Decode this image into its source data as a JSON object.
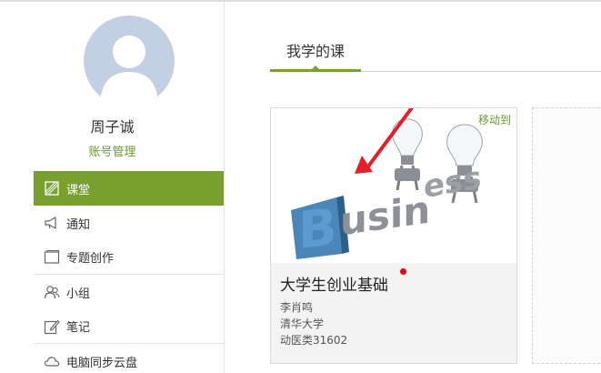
{
  "user": {
    "name": "周子诚",
    "account_link": "账号管理"
  },
  "nav": {
    "items": [
      {
        "label": "课堂",
        "icon": "classroom-icon"
      },
      {
        "label": "通知",
        "icon": "megaphone-icon"
      },
      {
        "label": "专题创作",
        "icon": "window-icon"
      },
      {
        "label": "小组",
        "icon": "group-icon"
      },
      {
        "label": "笔记",
        "icon": "edit-icon"
      },
      {
        "label": "电脑同步云盘",
        "icon": "cloud-icon"
      }
    ]
  },
  "main": {
    "tab_label": "我学的课",
    "course": {
      "move_label": "移动到",
      "title": "大学生创业基础",
      "teacher": "李肖鸣",
      "school": "清华大学",
      "class": "动医类31602",
      "cover_text": "Business"
    }
  },
  "colors": {
    "accent": "#77a02e",
    "link": "#6d9a2c",
    "dot": "#e60012"
  }
}
